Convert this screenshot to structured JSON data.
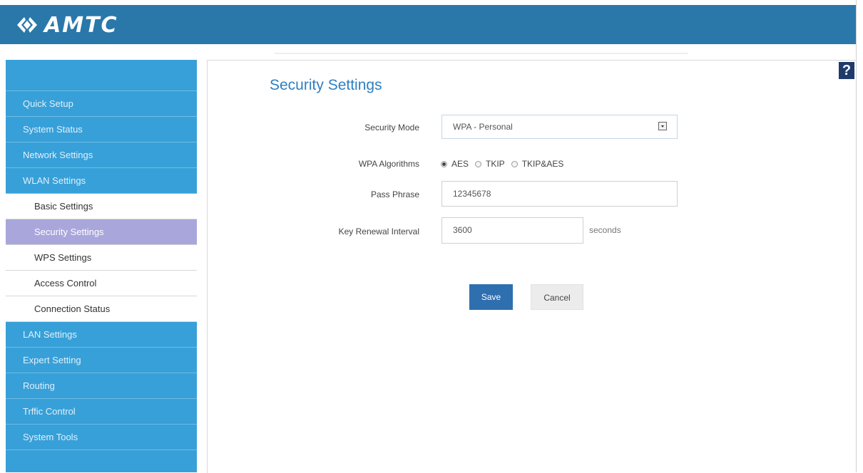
{
  "brand": {
    "name": "AMTC",
    "header_color": "#2a78aa"
  },
  "help": {
    "label": "?"
  },
  "sidebar": {
    "items": [
      {
        "label": "Quick Setup"
      },
      {
        "label": "System Status"
      },
      {
        "label": "Network Settings"
      },
      {
        "label": "WLAN Settings"
      }
    ],
    "sub_items": [
      {
        "label": "Basic Settings"
      },
      {
        "label": "Security Settings",
        "active": true
      },
      {
        "label": "WPS Settings"
      },
      {
        "label": "Access Control"
      },
      {
        "label": "Connection Status"
      }
    ],
    "items_after": [
      {
        "label": "LAN Settings"
      },
      {
        "label": "Expert Setting"
      },
      {
        "label": "Routing"
      },
      {
        "label": "Trffic Control"
      },
      {
        "label": "System Tools"
      }
    ]
  },
  "page": {
    "title": "Security Settings",
    "security_mode": {
      "label": "Security Mode",
      "value": "WPA - Personal"
    },
    "wpa_algorithms": {
      "label": "WPA Algorithms",
      "options": [
        "AES",
        "TKIP",
        "TKIP&AES"
      ],
      "selected": "AES"
    },
    "pass_phrase": {
      "label": "Pass Phrase",
      "value": "12345678"
    },
    "key_renewal": {
      "label": "Key Renewal Interval",
      "value": "3600",
      "unit": "seconds"
    },
    "save_label": "Save",
    "cancel_label": "Cancel"
  }
}
